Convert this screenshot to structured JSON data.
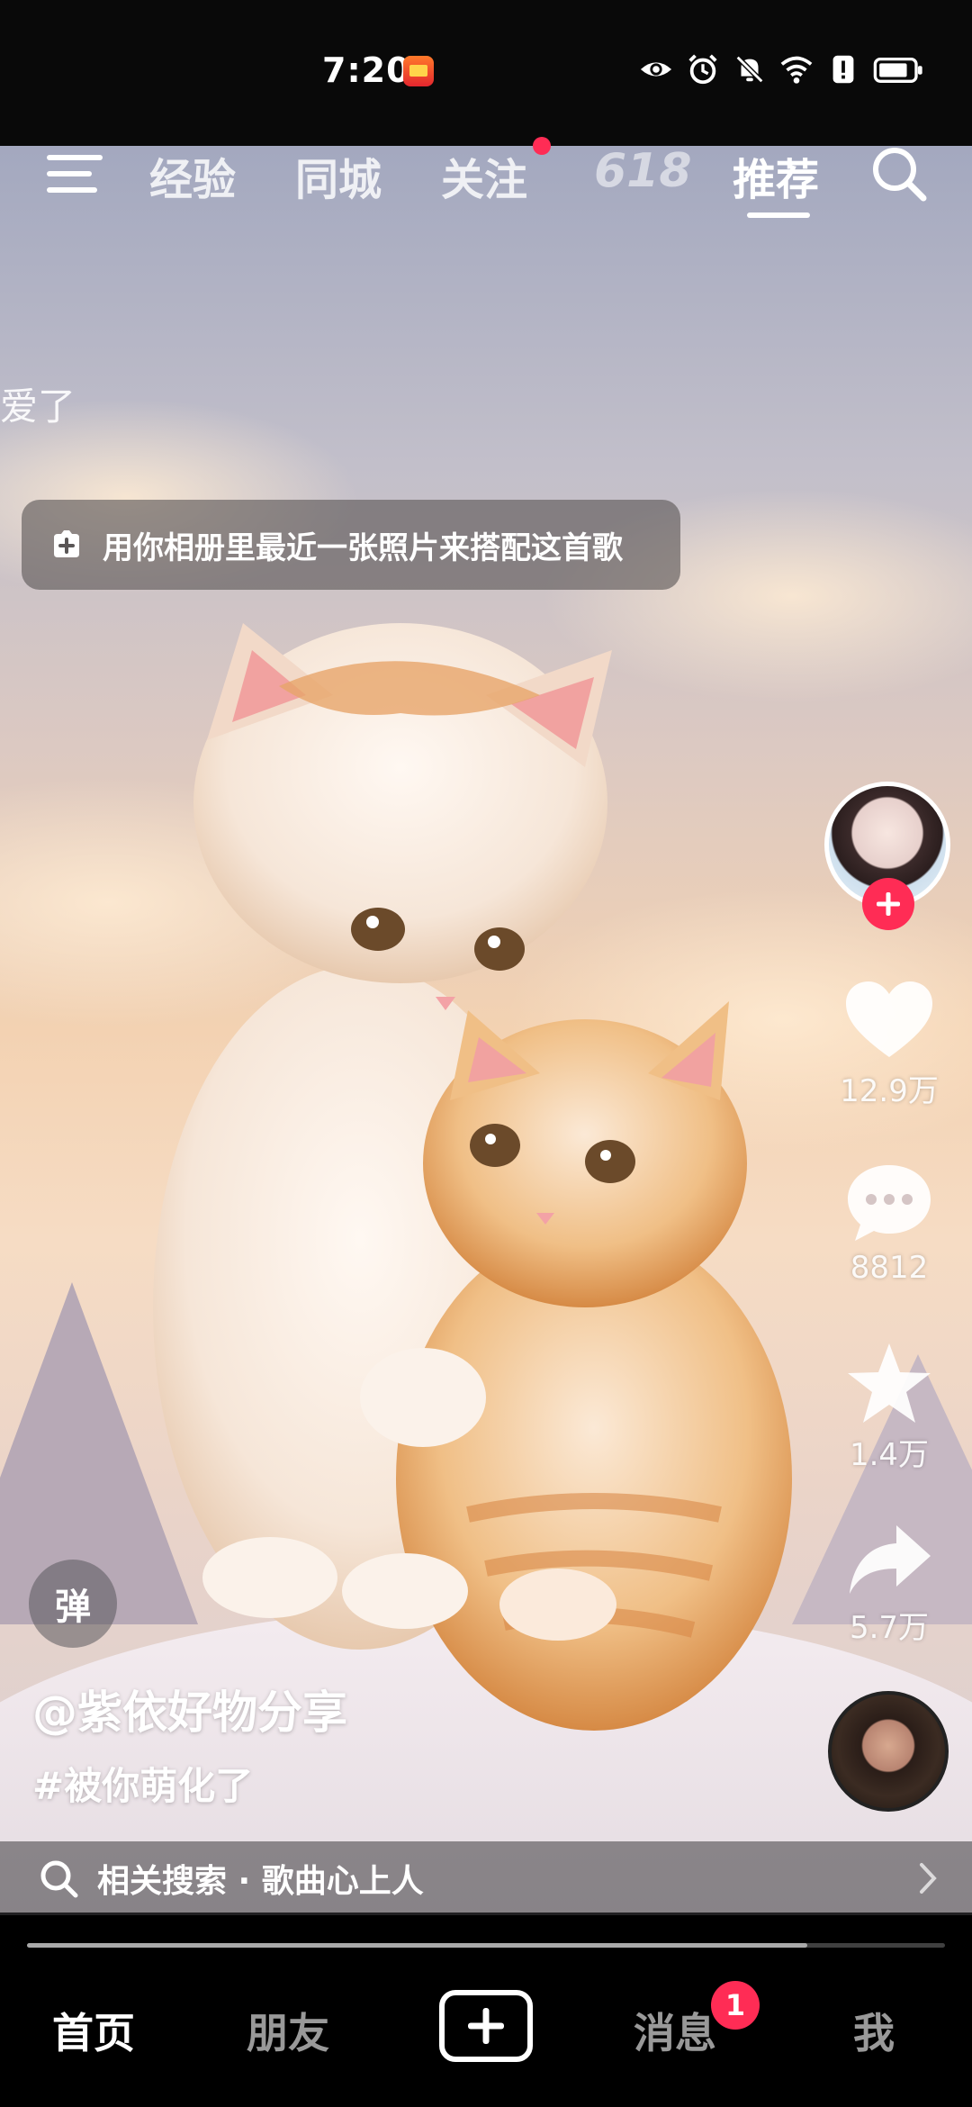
{
  "status_bar": {
    "time": "7:20",
    "icons": [
      "app-notification-icon",
      "eye-icon",
      "alarm-icon",
      "bell-mute-icon",
      "wifi-icon",
      "alert-icon",
      "battery-icon"
    ]
  },
  "top_nav": {
    "tabs": [
      {
        "label": "经验"
      },
      {
        "label": "同城"
      },
      {
        "label": "关注",
        "has_dot": true
      },
      {
        "label": "618"
      },
      {
        "label": "推荐",
        "active": true
      }
    ]
  },
  "overlay": {
    "side_text": "爱了",
    "music_prompt": "用你相册里最近一张照片来搭配这首歌"
  },
  "actions": {
    "like_count": "12.9万",
    "comment_count": "8812",
    "favorite_count": "1.4万",
    "share_count": "5.7万"
  },
  "video": {
    "danmu_label": "弹",
    "author": "@紫依好物分享",
    "hashtag": "#被你萌化了",
    "progress": 0.85
  },
  "related_search": {
    "text": "相关搜索 · 歌曲心上人"
  },
  "bottom_nav": {
    "items": [
      {
        "label": "首页",
        "active": true
      },
      {
        "label": "朋友"
      },
      {
        "label": "消息",
        "badge": "1"
      },
      {
        "label": "我"
      }
    ]
  },
  "colors": {
    "accent": "#ff2c55",
    "background": "#000000"
  }
}
